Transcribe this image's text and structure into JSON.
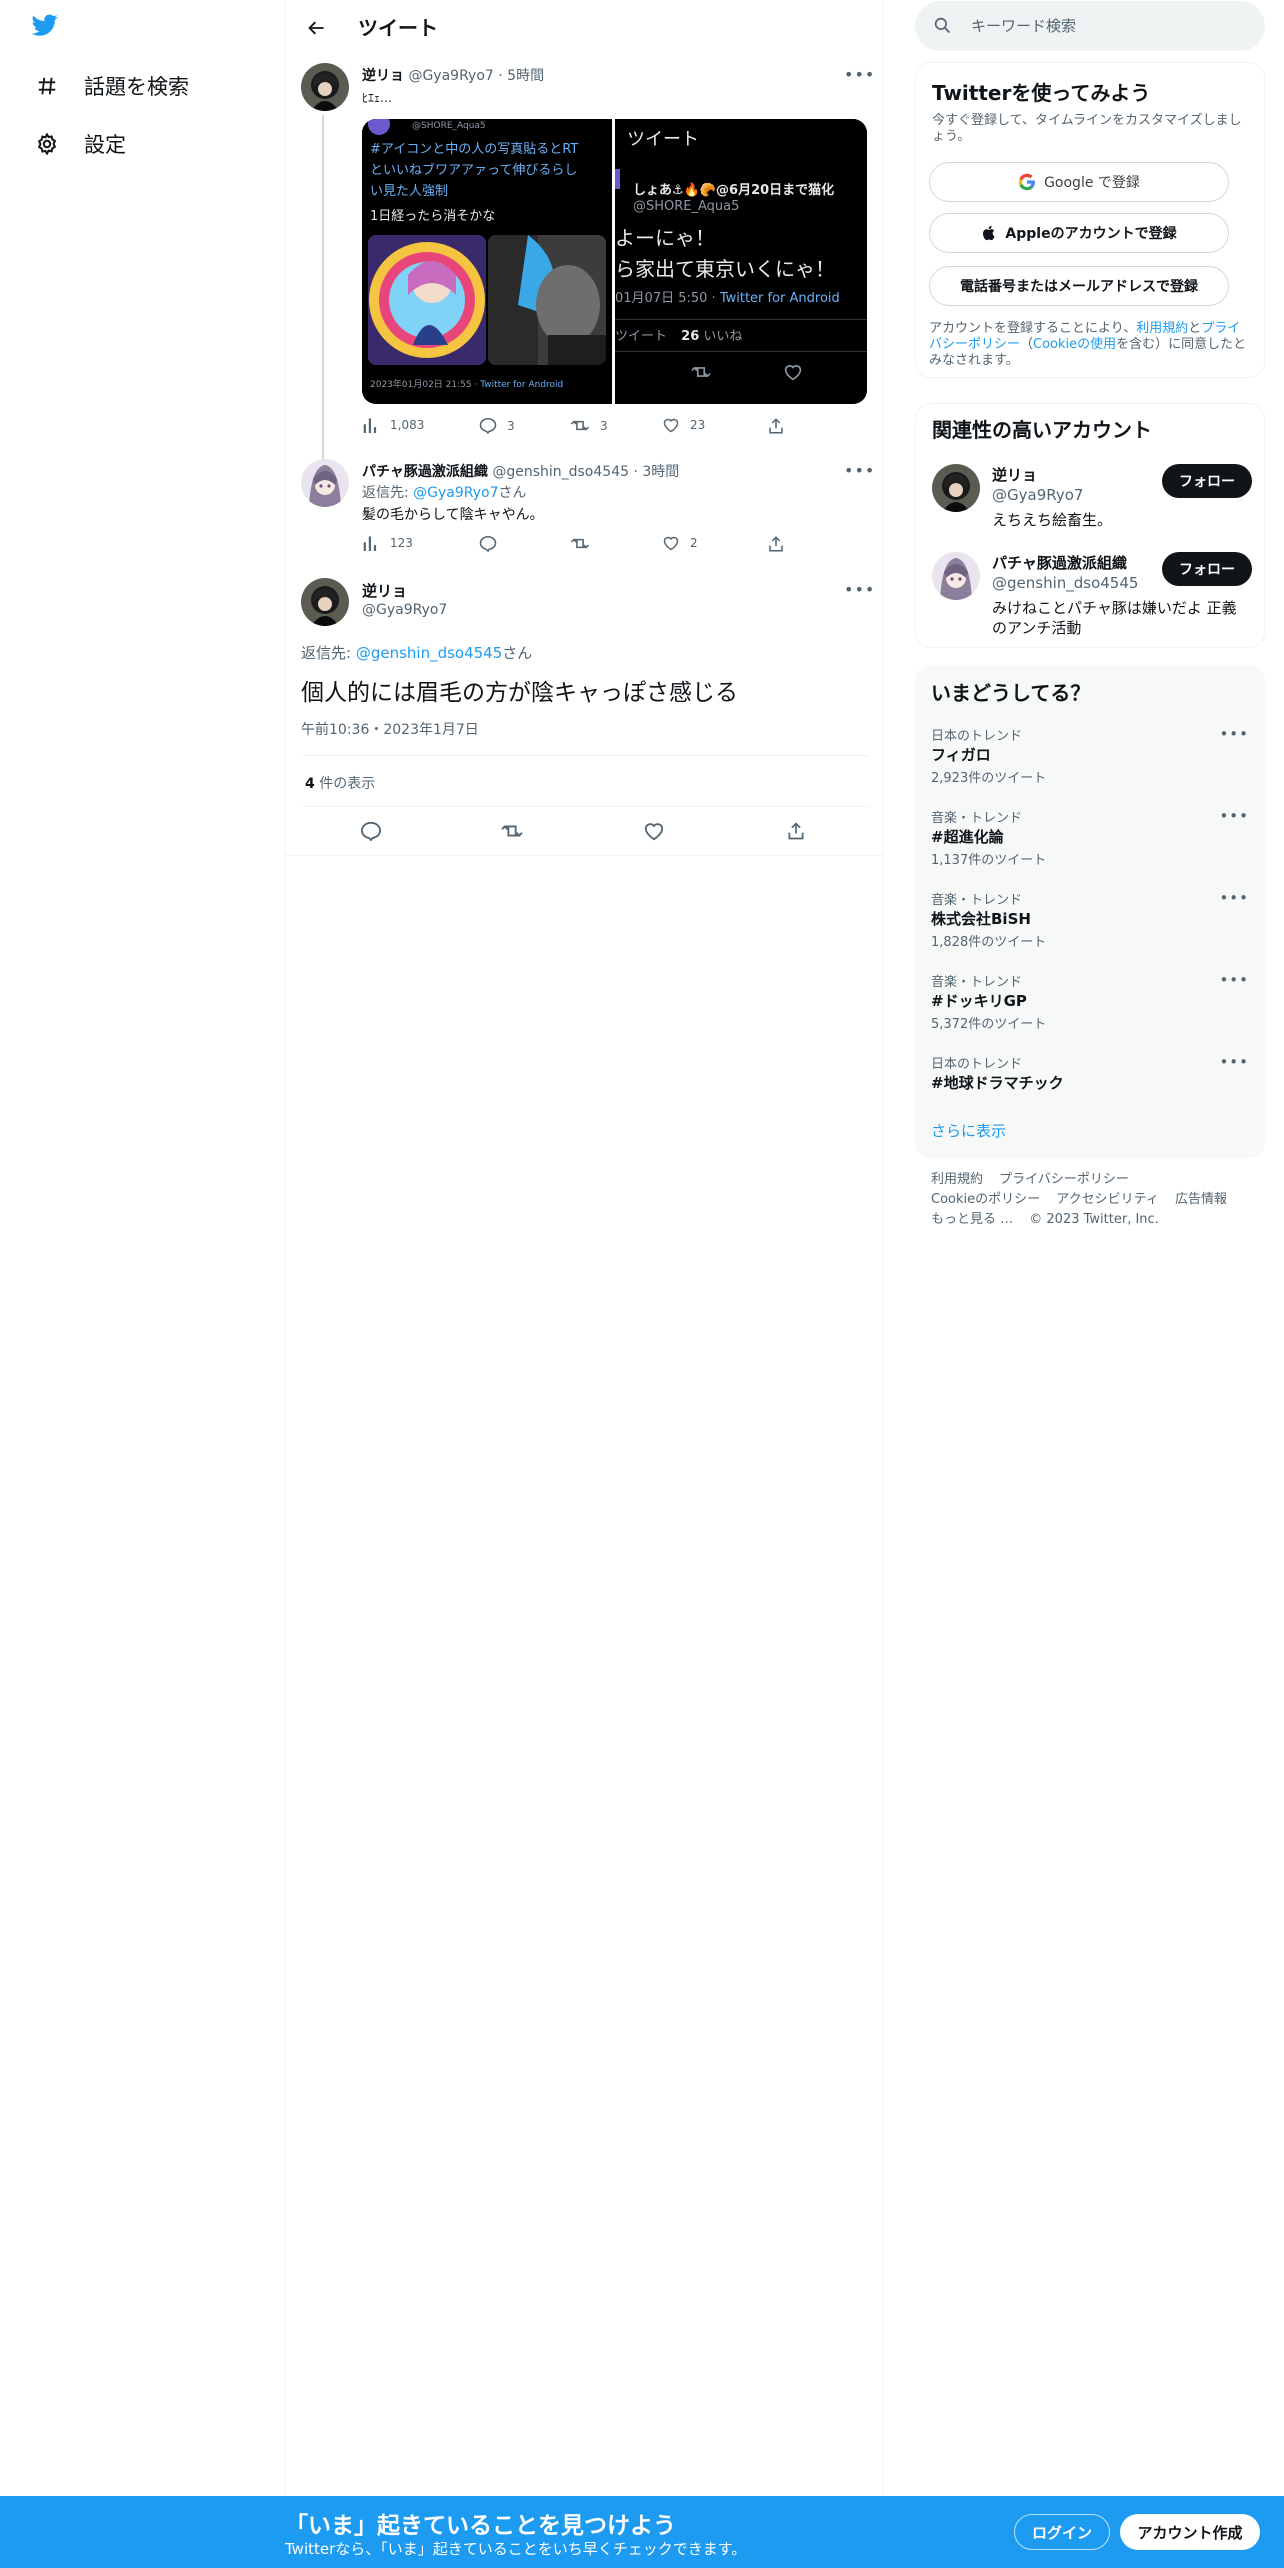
{
  "nav": {
    "explore_label": "話題を検索",
    "settings_label": "設定"
  },
  "header": {
    "title": "ツイート"
  },
  "tweet1": {
    "name": "逆リョ",
    "handle": "@Gya9Ryo7",
    "time": "5時間",
    "text": "ﾋｴｪ…",
    "media": {
      "left_handle": "@SHORE_Aqua5",
      "left_hashtag_line1": "#アイコンと中の人の写真貼るとRT",
      "left_hashtag_line2": "といいねブワアアァって伸びるらし",
      "left_hashtag_line3": "い見た人強制",
      "left_text": "1日経ったら消そかな",
      "left_footer_date": "2023年01月02日 21:55 · ",
      "left_footer_app": "Twitter for Android",
      "right_header": "ツイート",
      "right_name": "しょあ⚓🔥🥐@6月20日まで猫化",
      "right_handle": "@SHORE_Aqua5",
      "right_line1": "よーにゃ！",
      "right_line2": "ら家出て東京いくにゃ！",
      "right_date": "01月07日 5:50 · ",
      "right_app": "Twitter for Android",
      "right_stats_a": "ツイート",
      "right_likes_num": "26",
      "right_likes_label": "いいね"
    },
    "views": "1,083",
    "replies": "3",
    "retweets": "3",
    "likes": "23"
  },
  "tweet2": {
    "name": "パチャ豚過激派組織",
    "handle": "@genshin_dso4545",
    "time": "3時間",
    "reply_prefix": "返信先: ",
    "reply_to": "@Gya9Ryo7",
    "reply_suffix": "さん",
    "text": "髪の毛からして陰キャやん。",
    "views": "123",
    "likes": "2"
  },
  "focus": {
    "name": "逆リョ",
    "handle": "@Gya9Ryo7",
    "reply_prefix": "返信先: ",
    "reply_to": "@genshin_dso4545",
    "reply_suffix": "さん",
    "text": "個人的には眉毛の方が陰キャっぽさ感じる",
    "timestamp": "午前10:36・2023年1月7日",
    "views_count": "4",
    "views_label": " 件の表示"
  },
  "search": {
    "placeholder": "キーワード検索"
  },
  "signup_card": {
    "title": "Twitterを使ってみよう",
    "desc": "今すぐ登録して、タイムラインをカスタマイズしましょう。",
    "google": "Google で登録",
    "apple": "Appleのアカウントで登録",
    "phone": "電話番号またはメールアドレスで登録",
    "terms_a": "アカウントを登録することにより、",
    "terms_link1": "利用規約",
    "terms_b": "と",
    "terms_link2": "プライバシーポリシー",
    "terms_c": "（",
    "terms_link3": "Cookieの使用",
    "terms_d": "を含む）に同意したとみなされます。"
  },
  "related": {
    "title": "関連性の高いアカウント",
    "accounts": [
      {
        "name": "逆リョ",
        "handle": "@Gya9Ryo7",
        "bio": "えちえち絵畜生。",
        "follow": "フォロー"
      },
      {
        "name": "パチャ豚過激派組織",
        "handle": "@genshin_dso4545",
        "bio": "みけねことパチャ豚は嫌いだよ 正義のアンチ活動",
        "follow": "フォロー"
      }
    ]
  },
  "trends": {
    "title": "いまどうしてる？",
    "items": [
      {
        "meta": "日本のトレンド",
        "name": "フィガロ",
        "count": "2,923件のツイート"
      },
      {
        "meta": "音楽・トレンド",
        "name": "#超進化論",
        "count": "1,137件のツイート"
      },
      {
        "meta": "音楽・トレンド",
        "name": "株式会社BiSH",
        "count": "1,828件のツイート"
      },
      {
        "meta": "音楽・トレンド",
        "name": "#ドッキリGP",
        "count": "5,372件のツイート"
      },
      {
        "meta": "日本のトレンド",
        "name": "#地球ドラマチック",
        "count": ""
      }
    ],
    "show_more": "さらに表示"
  },
  "footer": {
    "terms": "利用規約",
    "privacy": "プライバシーポリシー",
    "cookie": "Cookieのポリシー",
    "accessibility": "アクセシビリティ",
    "ads": "広告情報",
    "more": "もっと見る …",
    "copyright": "© 2023 Twitter, Inc."
  },
  "banner": {
    "title": "「いま」起きていることを見つけよう",
    "sub": "Twitterなら、「いま」起きていることをいち早くチェックできます。",
    "login": "ログイン",
    "signup": "アカウント作成"
  },
  "colors": {
    "accent": "#1d9bf0",
    "text": "#0f1419",
    "muted": "#536471"
  }
}
